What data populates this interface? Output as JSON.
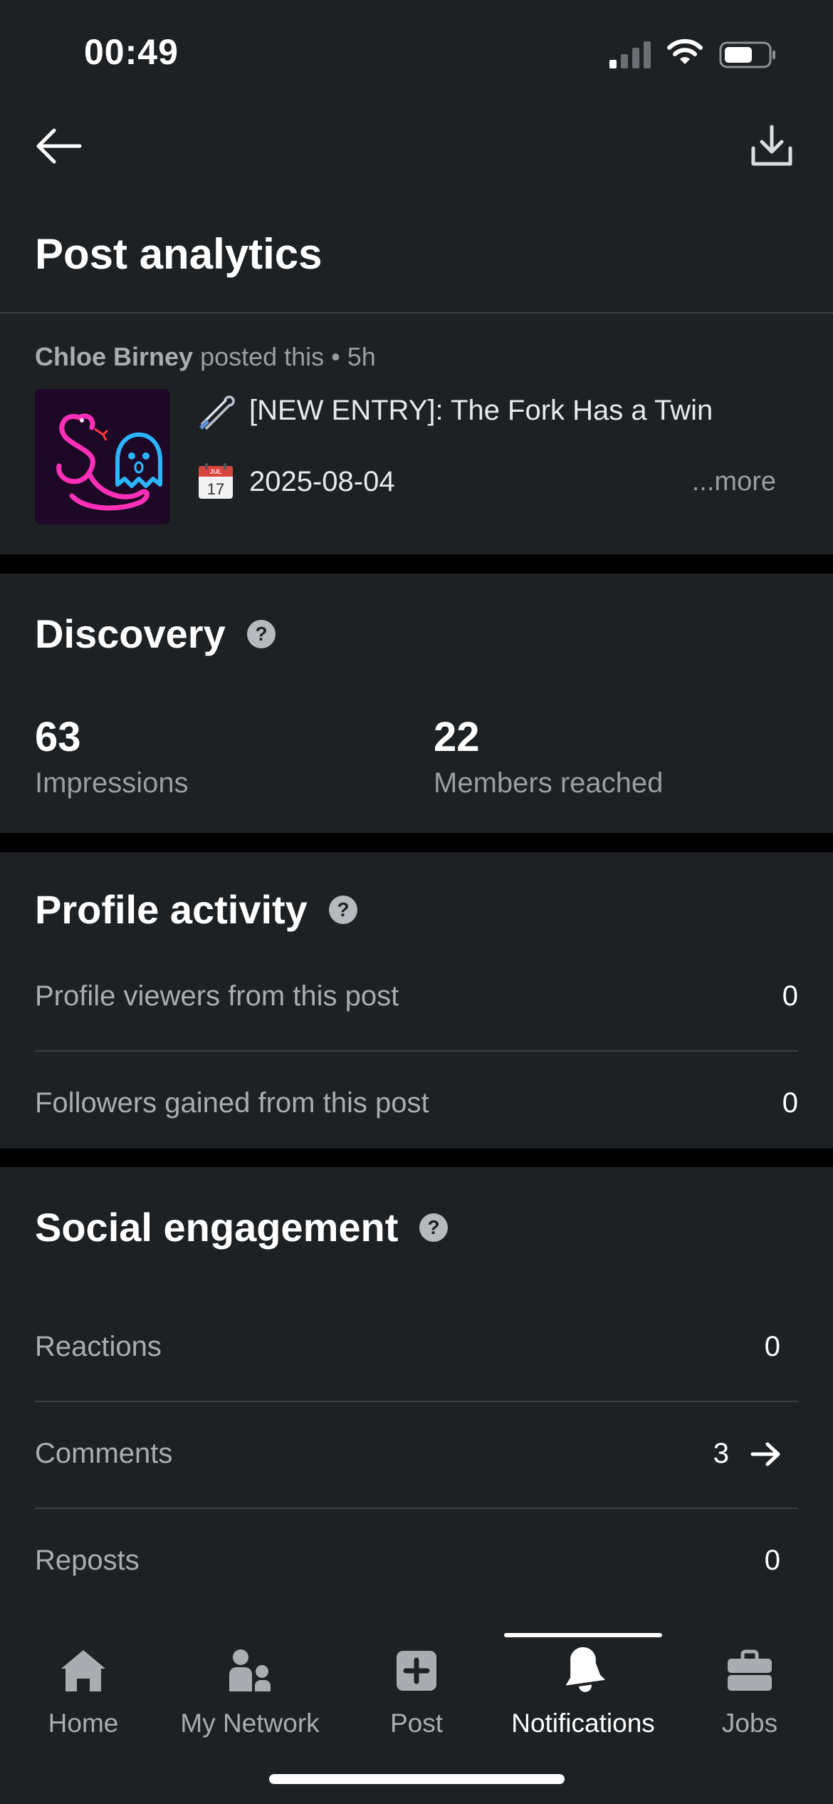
{
  "status_bar": {
    "time": "00:49"
  },
  "page": {
    "title": "Post analytics"
  },
  "post": {
    "author": "Chloe Birney",
    "meta_suffix": "posted this • 5h",
    "title": "[NEW ENTRY]: The Fork Has a Twin",
    "date": "2025-08-04",
    "more_label": "...more",
    "calendar_glyph": {
      "month": "JUL",
      "day": "17"
    }
  },
  "discovery": {
    "title": "Discovery",
    "stats": [
      {
        "value": "63",
        "label": "Impressions"
      },
      {
        "value": "22",
        "label": "Members reached"
      }
    ]
  },
  "profile_activity": {
    "title": "Profile activity",
    "rows": [
      {
        "label": "Profile viewers from this post",
        "value": "0"
      },
      {
        "label": "Followers gained from this post",
        "value": "0"
      }
    ]
  },
  "social_engagement": {
    "title": "Social engagement",
    "rows": [
      {
        "label": "Reactions",
        "value": "0"
      },
      {
        "label": "Comments",
        "value": "3"
      },
      {
        "label": "Reposts",
        "value": "0"
      }
    ]
  },
  "tabs": [
    {
      "label": "Home",
      "icon": "home-icon"
    },
    {
      "label": "My Network",
      "icon": "network-icon"
    },
    {
      "label": "Post",
      "icon": "plus-icon"
    },
    {
      "label": "Notifications",
      "icon": "bell-icon",
      "active": true
    },
    {
      "label": "Jobs",
      "icon": "briefcase-icon"
    }
  ],
  "colors": {
    "background": "#1e2124",
    "separator": "#000000",
    "text_primary": "#ffffff",
    "text_secondary": "#a9acb0",
    "divider": "#3b3f44"
  }
}
